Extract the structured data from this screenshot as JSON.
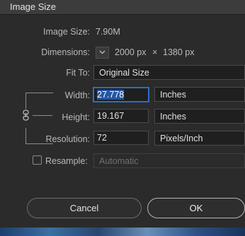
{
  "window": {
    "title": "Image Size"
  },
  "info": {
    "image_size_label": "Image Size:",
    "image_size_value": "7.90M",
    "dimensions_label": "Dimensions:",
    "dimensions_width": "2000 px",
    "dimensions_sep": "×",
    "dimensions_height": "1380 px"
  },
  "fit_to": {
    "label": "Fit To:",
    "value": "Original Size"
  },
  "width": {
    "label": "Width:",
    "value": "27.778",
    "unit": "Inches"
  },
  "height": {
    "label": "Height:",
    "value": "19.167",
    "unit": "Inches"
  },
  "resolution": {
    "label": "Resolution:",
    "value": "72",
    "unit": "Pixels/Inch"
  },
  "resample": {
    "label": "Resample:",
    "checked": false,
    "value": "Automatic"
  },
  "buttons": {
    "cancel": "Cancel",
    "ok": "OK"
  },
  "colors": {
    "background": "#2b2b2b",
    "focus_ring": "#2d6fbf",
    "selection": "#2556a3"
  },
  "icons": [
    "chevron-down-icon",
    "link-icon"
  ]
}
